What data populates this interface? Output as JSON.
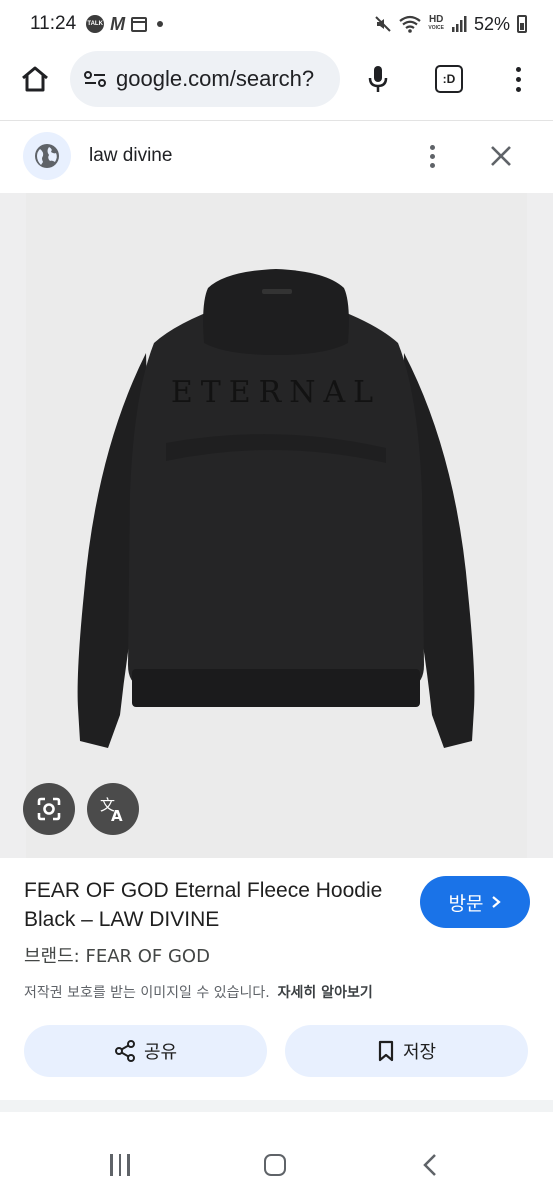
{
  "status_bar": {
    "time": "11:24",
    "talk_badge": "TALK",
    "m_icon": "M",
    "hd_top": "HD",
    "hd_bottom": "VOICE",
    "battery": "52%"
  },
  "browser": {
    "url": "google.com/search?",
    "tab_label": ":D"
  },
  "result_header": {
    "site_name": "law divine"
  },
  "image": {
    "print_text": "ETERNAL"
  },
  "product": {
    "title": "FEAR OF GOD Eternal Fleece Hoodie Black – LAW DIVINE",
    "visit_label": "방문",
    "brand": "브랜드: FEAR OF GOD",
    "copyright_notice": "저작권 보호를 받는 이미지일 수 있습니다.",
    "learn_more": "자세히 알아보기",
    "share_label": "공유",
    "save_label": "저장"
  },
  "colors": {
    "accent": "#1a73e8",
    "pill_bg": "#e8f0fe",
    "image_bg": "#ebebeb",
    "hoodie": "#232324"
  }
}
